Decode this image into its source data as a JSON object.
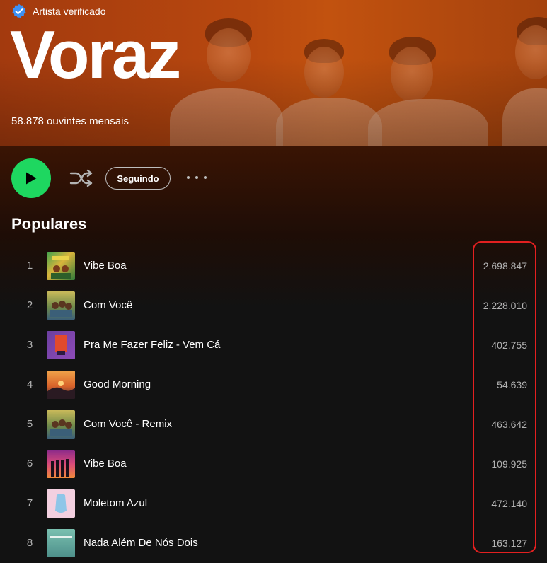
{
  "artist": {
    "verified_label": "Artista verificado",
    "name": "Voraz",
    "monthly_listeners": "58.878 ouvintes mensais"
  },
  "actions": {
    "play_icon": "play-icon",
    "shuffle_icon": "shuffle-icon",
    "follow_label": "Seguindo",
    "more_icon": "more-options-icon"
  },
  "popular": {
    "title": "Populares",
    "tracks": [
      {
        "num": "1",
        "title": "Vibe Boa",
        "plays": "2.698.847"
      },
      {
        "num": "2",
        "title": "Com Você",
        "plays": "2.228.010"
      },
      {
        "num": "3",
        "title": "Pra Me Fazer Feliz - Vem Cá",
        "plays": "402.755"
      },
      {
        "num": "4",
        "title": "Good Morning",
        "plays": "54.639"
      },
      {
        "num": "5",
        "title": "Com Você - Remix",
        "plays": "463.642"
      },
      {
        "num": "6",
        "title": "Vibe Boa",
        "plays": "109.925"
      },
      {
        "num": "7",
        "title": "Moletom Azul",
        "plays": "472.140"
      },
      {
        "num": "8",
        "title": "Nada Além De Nós Dois",
        "plays": "163.127"
      }
    ]
  },
  "colors": {
    "accent": "#1ed760",
    "hero": "#b8480f",
    "highlight": "#e32020",
    "verified_badge": "#3d91f4"
  }
}
